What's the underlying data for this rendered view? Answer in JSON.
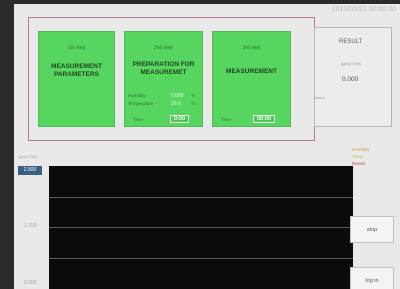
{
  "header": {
    "datetime": "2010/01/21 00:00:00"
  },
  "steps": [
    {
      "label": "1st step",
      "title_line1": "MEASUREMENT",
      "title_line2": "PARAMETERS"
    },
    {
      "label": "2nd step",
      "title_line1": "PREPARATION FOR",
      "title_line2": "MEASUREMET",
      "humidity_label": "Humidity",
      "humidity_value": "0.000",
      "humidity_unit": "%",
      "temperature_label": "Temperature",
      "temperature_value": "20.0",
      "temperature_unit": "°C",
      "time_label": "Time",
      "time_value": "0:00"
    },
    {
      "label": "3rd step",
      "title_line1": "MEASUREMENT",
      "time_label": "Time",
      "time_value": "00:00"
    }
  ],
  "result": {
    "title": "RESULT",
    "unit": "(g/m2·24h)",
    "value": "0.000",
    "status_label": "status"
  },
  "chart": {
    "y_label": "(g/m2·24h)",
    "y_top": "2.500",
    "y_mid": "1.250",
    "y_bottom": "0.000",
    "legend": [
      {
        "label": "Humidity",
        "color": "#d7a23a"
      },
      {
        "label": "Temp.",
        "color": "#b6c43a"
      },
      {
        "label": "Result",
        "color": "#d24a4a"
      }
    ]
  },
  "buttons": {
    "stop": "stop",
    "log": "log in"
  },
  "chart_data": {
    "type": "line",
    "ylabel": "(g/m2·24h)",
    "ylim": [
      0,
      2.5
    ],
    "yticks": [
      0,
      1.25,
      2.5
    ],
    "series": [
      {
        "name": "Humidity",
        "values": []
      },
      {
        "name": "Temp.",
        "values": []
      },
      {
        "name": "Result",
        "values": []
      }
    ],
    "grid": true,
    "legend": "top-right"
  }
}
